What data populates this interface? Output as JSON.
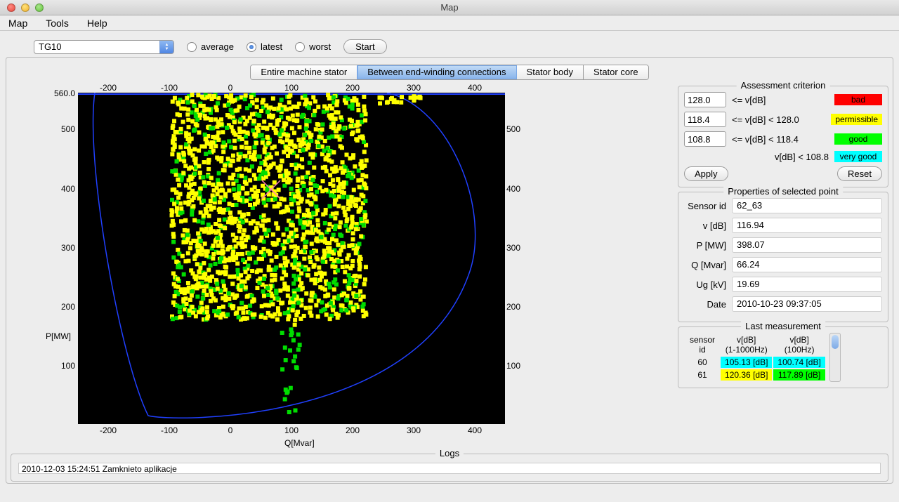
{
  "window_title": "Map",
  "menu": {
    "map": "Map",
    "tools": "Tools",
    "help": "Help"
  },
  "toolbar": {
    "device_selected": "TG10",
    "radio_average": "average",
    "radio_latest": "latest",
    "radio_worst": "worst",
    "start_btn": "Start"
  },
  "tabs": {
    "t1": "Entire machine stator",
    "t2": "Between end-winding connections",
    "t3": "Stator body",
    "t4": "Stator core"
  },
  "criterion": {
    "title": "Assessment criterion",
    "v1": "128.0",
    "v1_txt": "<= v[dB]",
    "bad": "bad",
    "v2": "118.4",
    "v2_txt": "<= v[dB] < 128.0",
    "permissible": "permissible",
    "v3": "108.8",
    "v3_txt": "<= v[dB] < 118.4",
    "good": "good",
    "v4_txt": "v[dB] < 108.8",
    "very_good": "very good",
    "apply": "Apply",
    "reset": "Reset"
  },
  "selected": {
    "title": "Properties of selected point",
    "sensor_l": "Sensor id",
    "sensor_v": "62_63",
    "v_l": "v [dB]",
    "v_v": "116.94",
    "p_l": "P [MW]",
    "p_v": "398.07",
    "q_l": "Q [Mvar]",
    "q_v": "66.24",
    "ug_l": "Ug [kV]",
    "ug_v": "19.69",
    "date_l": "Date",
    "date_v": "2010-10-23 09:37:05"
  },
  "last": {
    "title": "Last measurement",
    "h_sensor": "sensor id",
    "h_v1": "v[dB] (1-1000Hz)",
    "h_v2": "v[dB] (100Hz)",
    "r1_id": "60",
    "r1_v1": "105.13 [dB]",
    "r1_v2": "100.74 [dB]",
    "r2_id": "61",
    "r2_v1": "120.36 [dB]",
    "r2_v2": "117.89 [dB]"
  },
  "logs": {
    "title": "Logs",
    "line": "2010-12-03 15:24:51 Zamknieto aplikacje"
  },
  "chart_data": {
    "type": "scatter",
    "title": "",
    "xlabel": "Q[Mvar]",
    "ylabel": "P[MW]",
    "xlim": [
      -250,
      450
    ],
    "ylim": [
      0,
      560
    ],
    "xticks": [
      -200,
      -100,
      0,
      100,
      200,
      300,
      400
    ],
    "yticks": [
      100,
      200,
      300,
      400,
      500,
      "560.0"
    ],
    "series_note": "Dense operating-point map colored by v[dB] assessment category (yellow=permissible, green=good). Exact per-point values not readable; representative cluster summarised.",
    "boundary_curve": "Capability curve (blue) approx through points: (-200,560),(-120,50),(-50,-), (440,300),(300,560)",
    "selected_point": {
      "Q": 66.24,
      "P": 398.07,
      "v_dB": 116.94
    },
    "clusters": [
      {
        "color": "yellow",
        "q_range": [
          -100,
          230
        ],
        "p_range": [
          180,
          560
        ],
        "density": "high"
      },
      {
        "color": "green",
        "q_range": [
          -50,
          230
        ],
        "p_range": [
          200,
          560
        ],
        "density": "medium (interspersed)"
      },
      {
        "color": "green",
        "q_range": [
          70,
          110
        ],
        "p_range": [
          20,
          200
        ],
        "density": "sparse vertical tail"
      },
      {
        "color": "yellow",
        "q_range": [
          70,
          110
        ],
        "p_range": [
          160,
          260
        ],
        "density": "sparse vertical tail"
      }
    ]
  }
}
